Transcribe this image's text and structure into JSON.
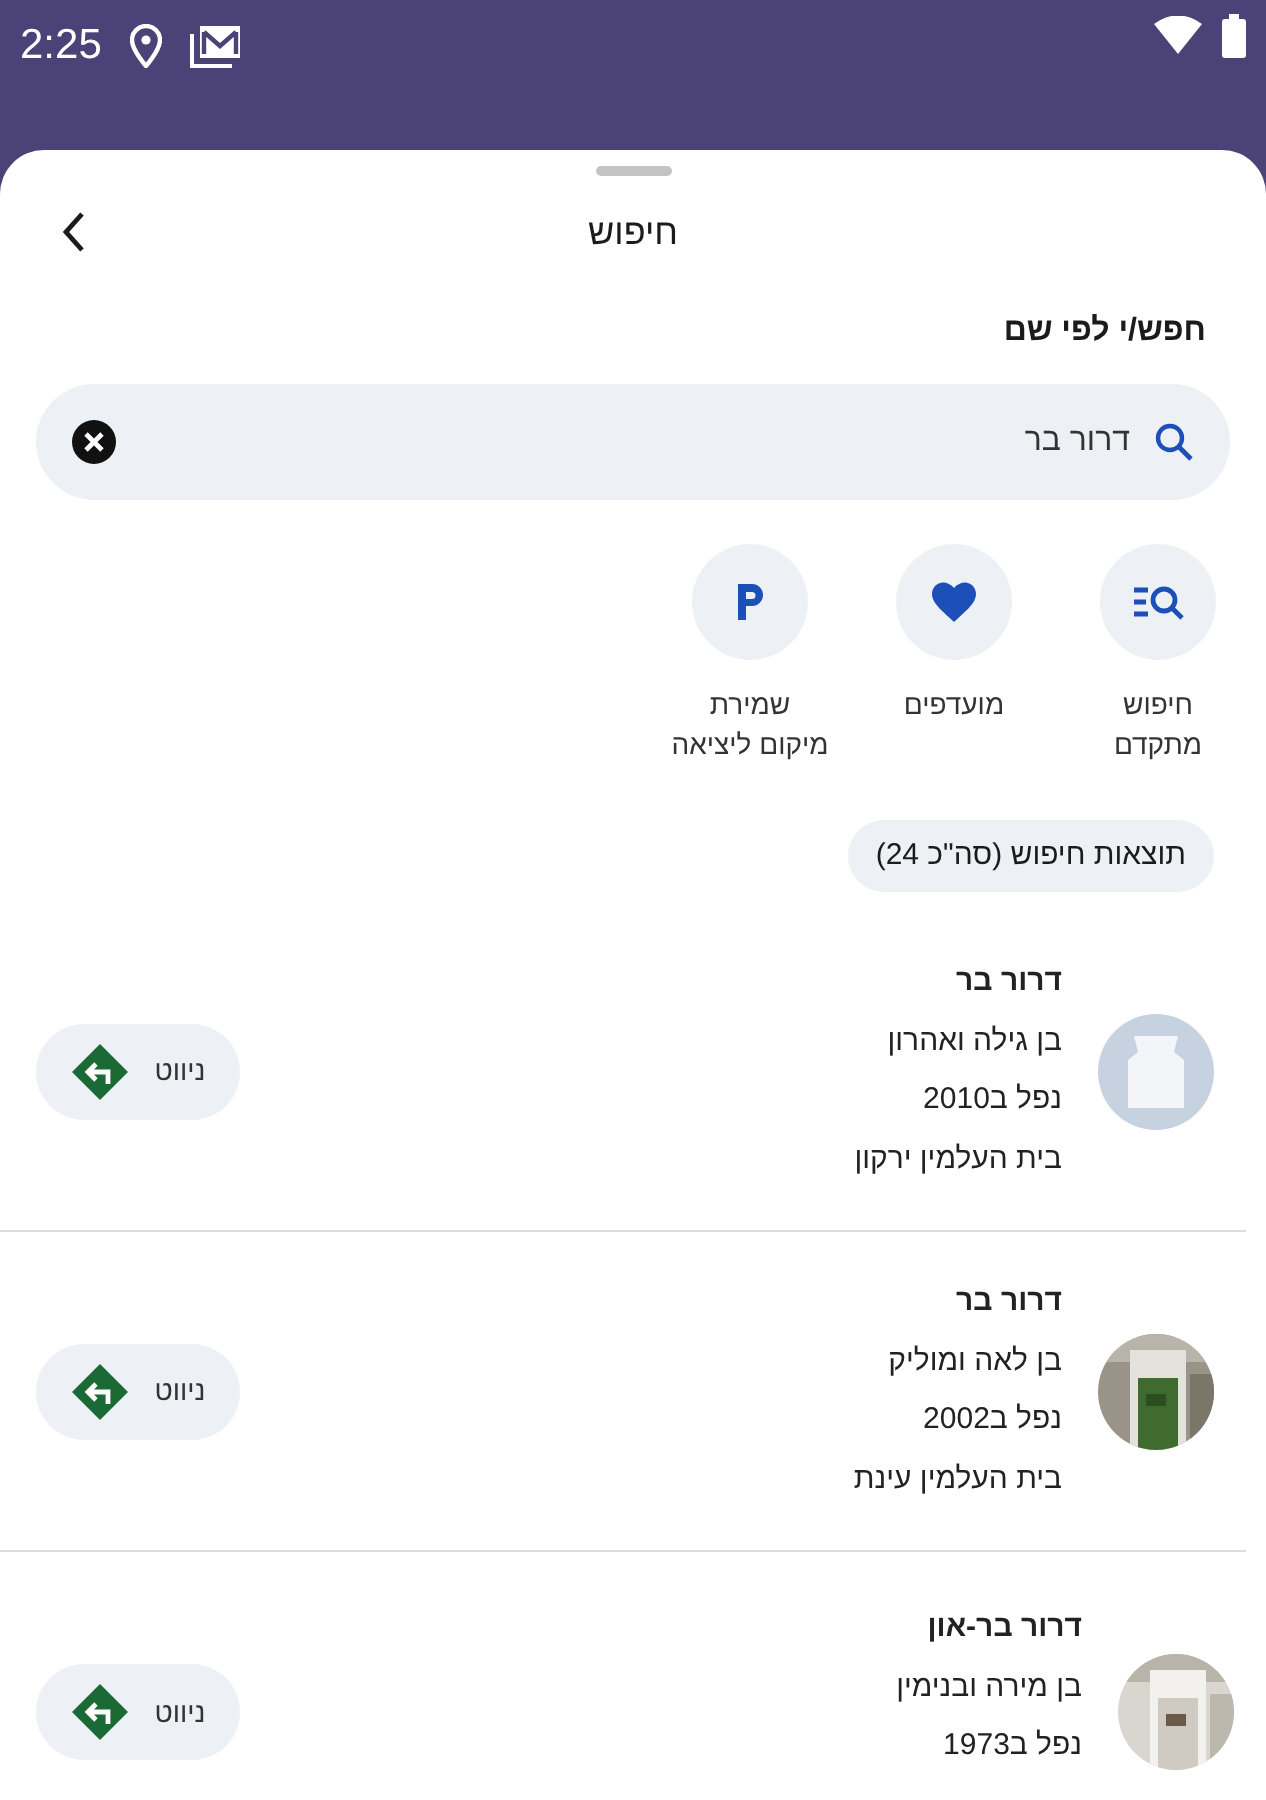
{
  "status_bar": {
    "time": "2:25"
  },
  "header": {
    "title": "חיפוש"
  },
  "search": {
    "label": "חפש/י לפי שם",
    "value": "דרור בר"
  },
  "quick_actions": [
    {
      "kind": "advanced",
      "label": "חיפוש\nמתקדם"
    },
    {
      "kind": "favorites",
      "label": "מועדפים"
    },
    {
      "kind": "parking",
      "label": "שמירת\nמיקום ליציאה"
    }
  ],
  "results_chip": "תוצאות חיפוש (סה\"כ 24)",
  "results": [
    {
      "kind": "placeholder",
      "name": "דרור בר",
      "parents": "בן גילה ואהרון",
      "fell": "נפל ב2010",
      "cemetery": "בית העלמין ירקון",
      "navigate": "ניווט"
    },
    {
      "kind": "picture",
      "name": "דרור בר",
      "parents": "בן לאה ומוליק",
      "fell": "נפל ב2002",
      "cemetery": "בית העלמין עינת",
      "navigate": "ניווט"
    },
    {
      "kind": "picture",
      "name": "דרור בר-און",
      "parents": "בן מירה ובנימין",
      "fell": "נפל ב1973",
      "navigate": "ניווט"
    }
  ]
}
